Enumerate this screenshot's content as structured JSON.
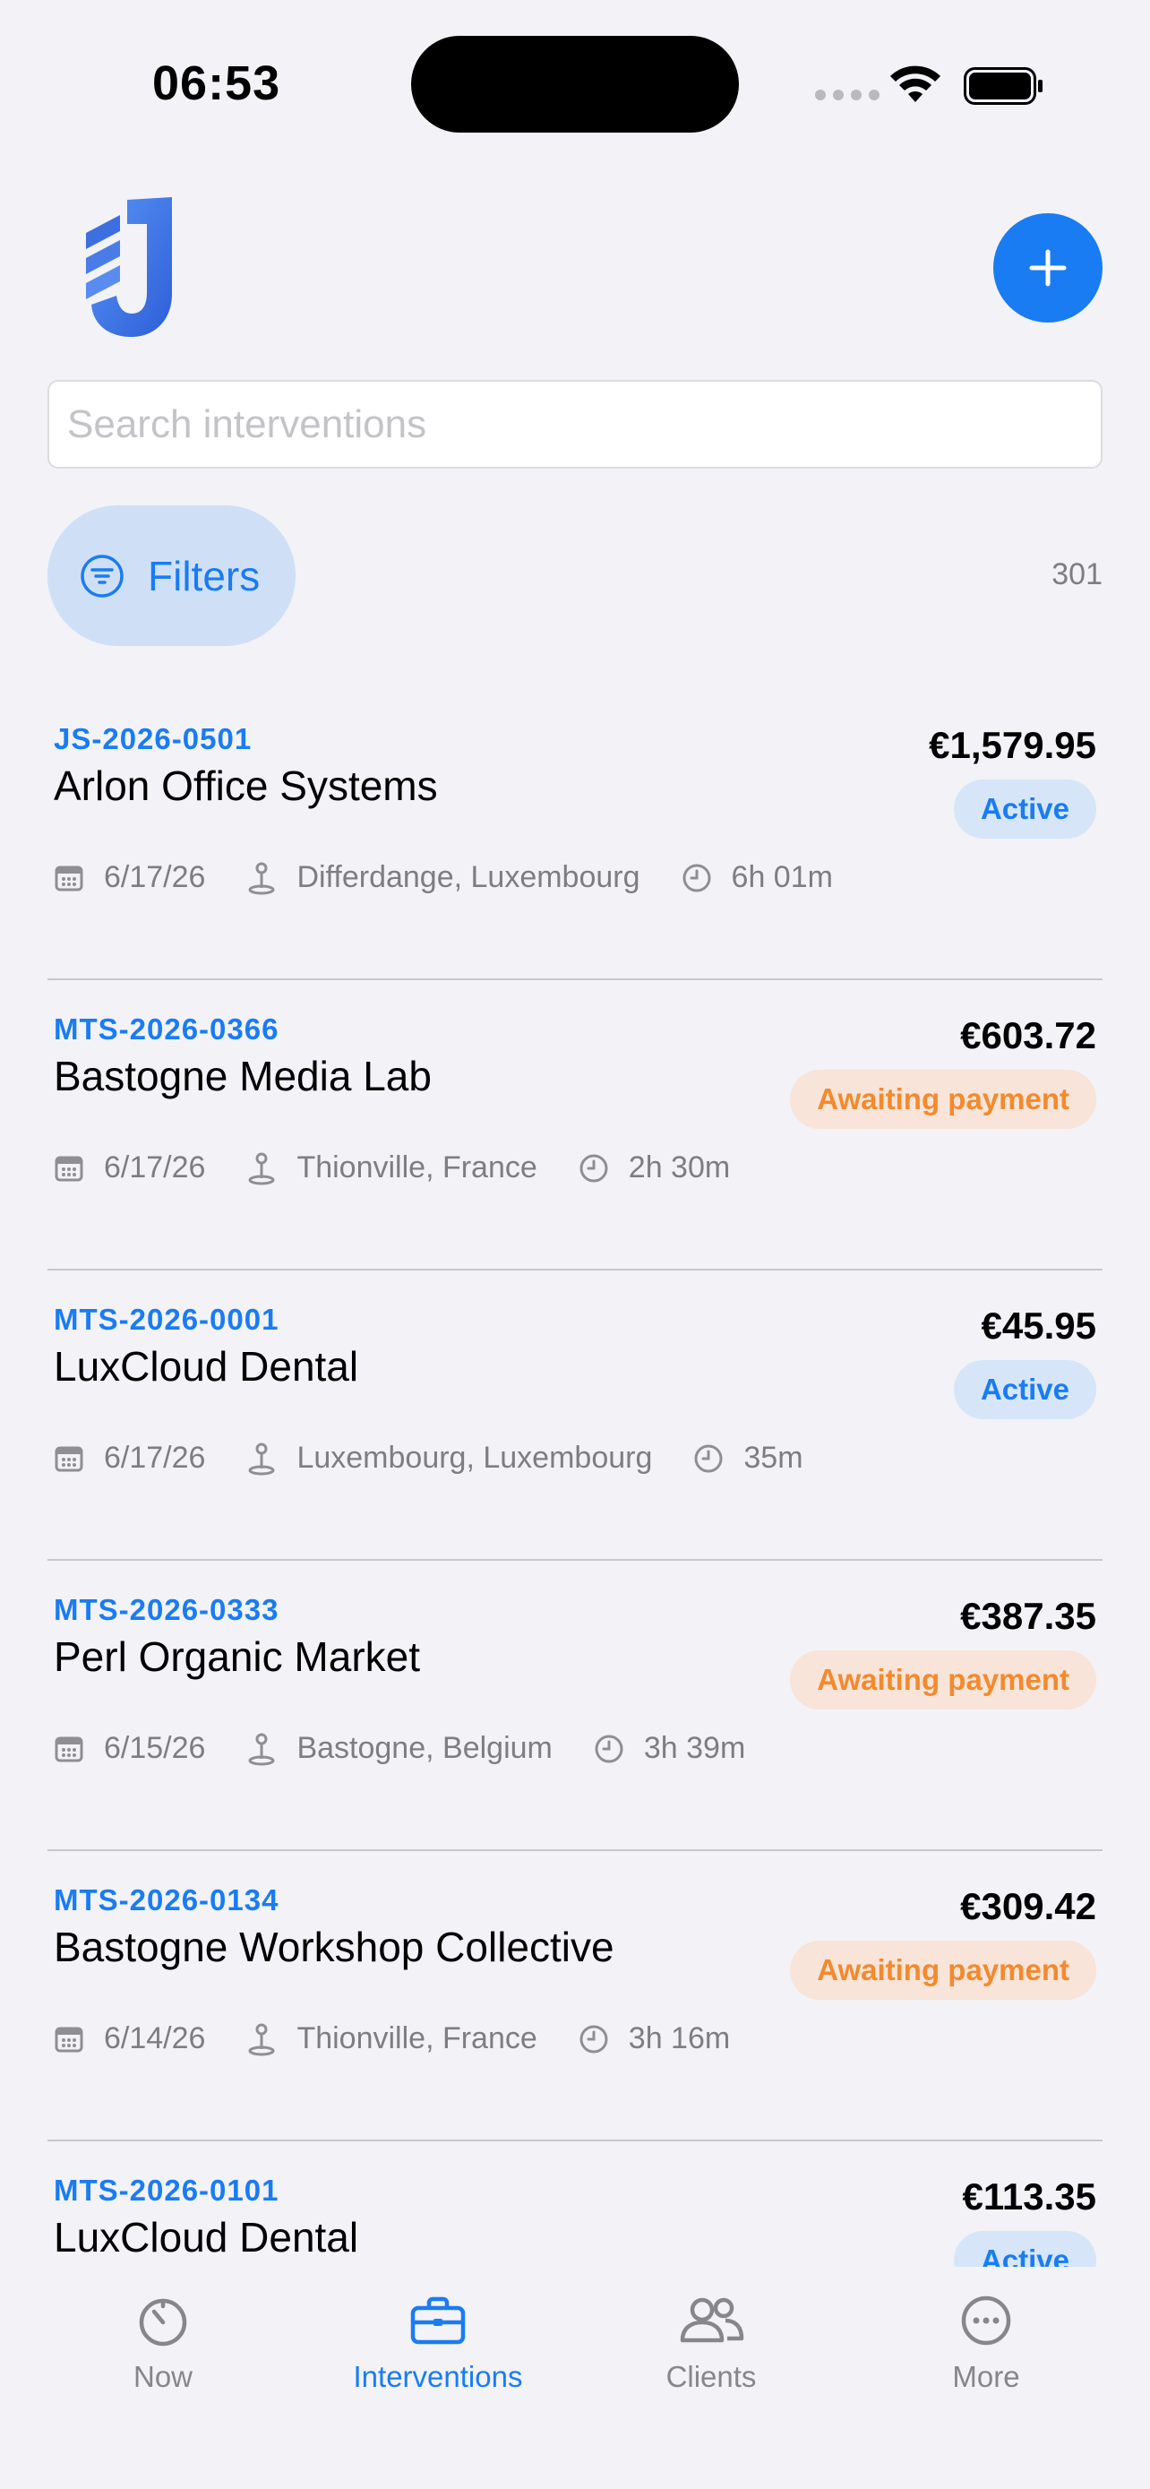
{
  "status_bar": {
    "time": "06:53"
  },
  "header": {
    "search_placeholder": "Search interventions",
    "filters_label": "Filters",
    "count": "301"
  },
  "colors": {
    "accent": "#1a7cf2",
    "active_bg": "#d6e6f8",
    "await_bg": "#f8e4d8",
    "await_text": "#f28a2e"
  },
  "interventions": [
    {
      "ref": "JS-2026-0501",
      "client": "Arlon Office Systems",
      "amount": "€1,579.95",
      "status": "Active",
      "date": "6/17/26",
      "location": "Differdange, Luxembourg",
      "duration": "6h 01m"
    },
    {
      "ref": "MTS-2026-0366",
      "client": "Bastogne Media Lab",
      "amount": "€603.72",
      "status": "Awaiting payment",
      "date": "6/17/26",
      "location": "Thionville, France",
      "duration": "2h 30m"
    },
    {
      "ref": "MTS-2026-0001",
      "client": "LuxCloud Dental",
      "amount": "€45.95",
      "status": "Active",
      "date": "6/17/26",
      "location": "Luxembourg, Luxembourg",
      "duration": "35m"
    },
    {
      "ref": "MTS-2026-0333",
      "client": "Perl Organic Market",
      "amount": "€387.35",
      "status": "Awaiting payment",
      "date": "6/15/26",
      "location": "Bastogne, Belgium",
      "duration": "3h 39m"
    },
    {
      "ref": "MTS-2026-0134",
      "client": "Bastogne Workshop Collective",
      "amount": "€309.42",
      "status": "Awaiting payment",
      "date": "6/14/26",
      "location": "Thionville, France",
      "duration": "3h 16m"
    },
    {
      "ref": "MTS-2026-0101",
      "client": "LuxCloud Dental",
      "amount": "€113.35",
      "status": "Active"
    }
  ],
  "tabs": [
    {
      "label": "Now",
      "icon": "timer-icon"
    },
    {
      "label": "Interventions",
      "icon": "briefcase-icon"
    },
    {
      "label": "Clients",
      "icon": "people-icon"
    },
    {
      "label": "More",
      "icon": "ellipsis-circle-icon"
    }
  ]
}
